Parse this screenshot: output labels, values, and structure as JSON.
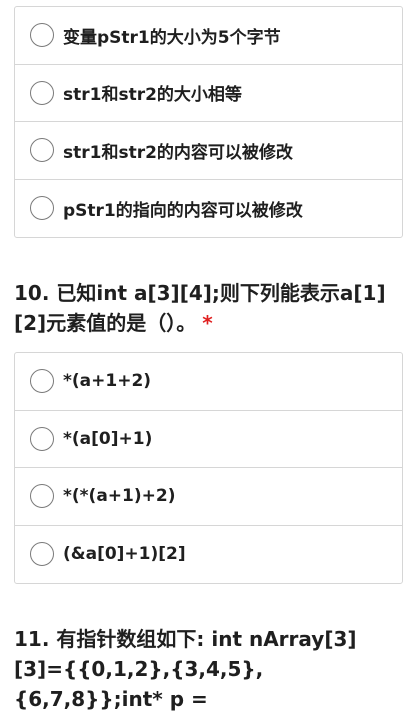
{
  "q9": {
    "options": [
      "变量pStr1的大小为5个字节",
      "str1和str2的大小相等",
      "str1和str2的内容可以被修改",
      "pStr1的指向的内容可以被修改"
    ]
  },
  "q10": {
    "title": "10. 已知int a[3][4];则下列能表示a[1][2]元素值的是（）。",
    "required_mark": "*",
    "options": [
      "*(a+1+2)",
      "*(a[0]+1)",
      "*(*(a+1)+2)",
      "(&a[0]+1)[2]"
    ]
  },
  "q11": {
    "title": "11. 有指针数组如下: int nArray[3][3]={{0,1,2},{3,4,5},{6,7,8}};int* p ="
  },
  "colors": {
    "required": "#e02020",
    "border": "#d6d6d6"
  }
}
